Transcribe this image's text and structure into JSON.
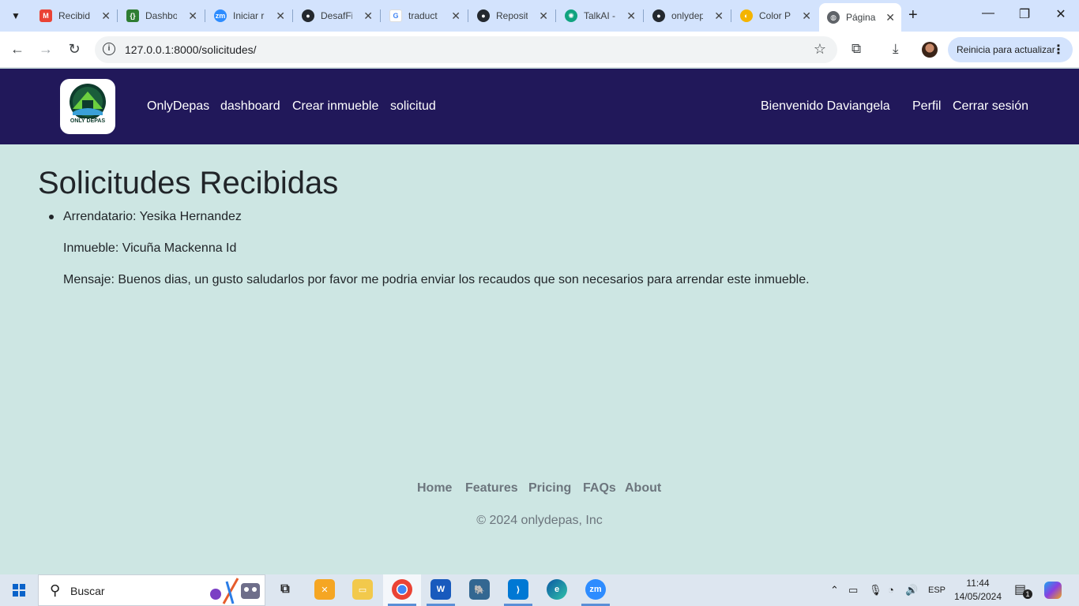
{
  "browser": {
    "tabs": [
      {
        "label": "Recibid",
        "icon": "gmail-icon",
        "color": "#ea4335"
      },
      {
        "label": "Dashbo",
        "icon": "dashboard-icon",
        "color": "#2e7d32"
      },
      {
        "label": "Iniciar r",
        "icon": "zoom-icon",
        "color": "#2d8cff"
      },
      {
        "label": "DesafFi",
        "icon": "github-icon",
        "color": "#24292f"
      },
      {
        "label": "traduct",
        "icon": "google-icon",
        "color": "#4285f4"
      },
      {
        "label": "Reposit",
        "icon": "github-icon",
        "color": "#24292f"
      },
      {
        "label": "TalkAI -",
        "icon": "talkai-icon",
        "color": "#10a37f"
      },
      {
        "label": "onlydep",
        "icon": "github-icon",
        "color": "#24292f"
      },
      {
        "label": "Color P",
        "icon": "colorpicker-icon",
        "color": "#e53935"
      },
      {
        "label": "Página",
        "icon": "globe-icon",
        "color": "#5f6368"
      }
    ],
    "url": "127.0.0.1:8000/solicitudes/",
    "update_button": "Reinicia para actualizar"
  },
  "site": {
    "logo_text": "ONLY DEPAS",
    "nav": [
      "OnlyDepas",
      "dashboard",
      "Crear inmueble",
      "solicitud"
    ],
    "welcome": "Bienvenido Daviangela",
    "profile": "Perfil",
    "logout": "Cerrar sesión"
  },
  "main": {
    "title": "Solicitudes Recibidas",
    "request": {
      "tenant": "Arrendatario: Yesika Hernandez",
      "property": "Inmueble: Vicuña Mackenna Id",
      "message": "Mensaje: Buenos dias, un gusto saludarlos por favor me podria enviar los recaudos que son necesarios para arrendar este inmueble."
    }
  },
  "footer": {
    "links": [
      "Home",
      "Features",
      "Pricing",
      "FAQs",
      "About"
    ],
    "copyright": "© 2024 onlydepas, Inc"
  },
  "taskbar": {
    "search_placeholder": "Buscar",
    "language": "ESP",
    "time": "11:44",
    "date": "14/05/2024",
    "notification_count": "1"
  },
  "colors": {
    "header_bg": "#21185a",
    "page_bg": "#cde6e3",
    "footer_text": "#6c757d"
  }
}
